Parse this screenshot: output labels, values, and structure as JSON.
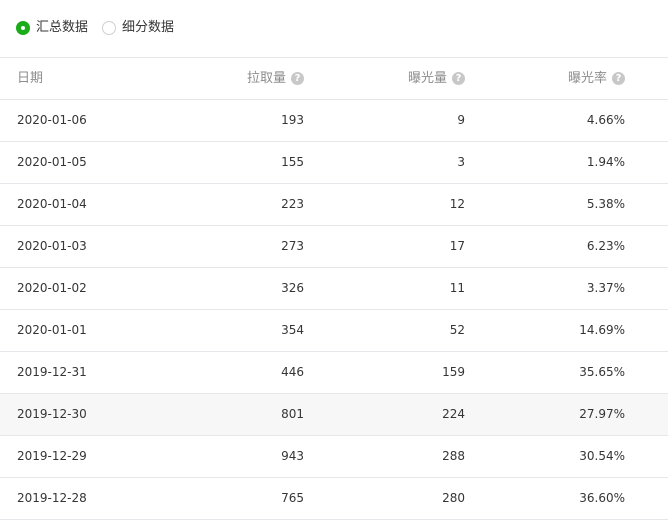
{
  "view_toggle": {
    "options": [
      {
        "label": "汇总数据",
        "checked": true
      },
      {
        "label": "细分数据",
        "checked": false
      }
    ]
  },
  "table": {
    "columns": {
      "date": "日期",
      "pulls": "拉取量",
      "exposures": "曝光量",
      "exposure_rate": "曝光率"
    },
    "help_icon_glyph": "?",
    "rows": [
      {
        "date": "2020-01-06",
        "pulls": "193",
        "exposures": "9",
        "rate": "4.66%"
      },
      {
        "date": "2020-01-05",
        "pulls": "155",
        "exposures": "3",
        "rate": "1.94%"
      },
      {
        "date": "2020-01-04",
        "pulls": "223",
        "exposures": "12",
        "rate": "5.38%"
      },
      {
        "date": "2020-01-03",
        "pulls": "273",
        "exposures": "17",
        "rate": "6.23%"
      },
      {
        "date": "2020-01-02",
        "pulls": "326",
        "exposures": "11",
        "rate": "3.37%"
      },
      {
        "date": "2020-01-01",
        "pulls": "354",
        "exposures": "52",
        "rate": "14.69%"
      },
      {
        "date": "2019-12-31",
        "pulls": "446",
        "exposures": "159",
        "rate": "35.65%"
      },
      {
        "date": "2019-12-30",
        "pulls": "801",
        "exposures": "224",
        "rate": "27.97%"
      },
      {
        "date": "2019-12-29",
        "pulls": "943",
        "exposures": "288",
        "rate": "30.54%"
      },
      {
        "date": "2019-12-28",
        "pulls": "765",
        "exposures": "280",
        "rate": "36.60%"
      }
    ]
  },
  "colors": {
    "accent": "#1aad19",
    "header_text": "#8d8d8d",
    "body_text": "#353535",
    "divider": "#e7e7eb",
    "hover_row": "#f7f7f7"
  }
}
